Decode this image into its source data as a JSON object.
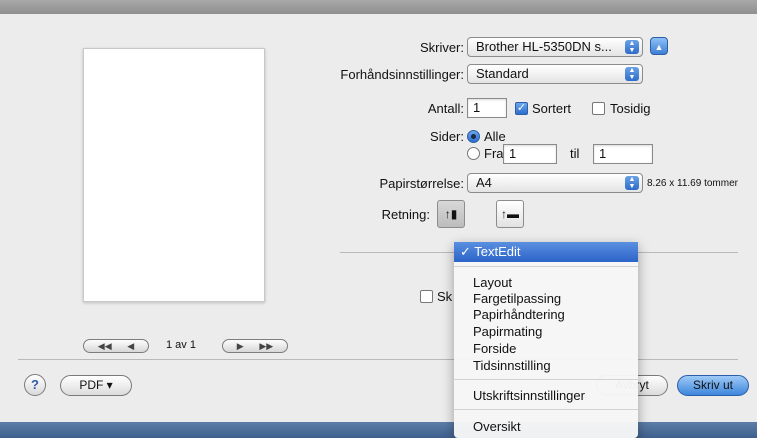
{
  "dialog": {
    "printer_label": "Skriver:",
    "printer_value": "Brother HL-5350DN s...",
    "presets_label": "Forhåndsinnstillinger:",
    "presets_value": "Standard",
    "copies_label": "Antall:",
    "copies_value": "1",
    "collated_label": "Sortert",
    "collated_checked": true,
    "twosided_label": "Tosidig",
    "twosided_checked": false,
    "pages_label": "Sider:",
    "pages_all_label": "Alle",
    "pages_from_label": "Fra",
    "pages_from_value": "1",
    "pages_to_label": "til",
    "pages_to_value": "1",
    "papersize_label": "Papirstørrelse:",
    "papersize_value": "A4",
    "papersize_dims": "8.26 x 11.69 tommer",
    "orientation_label": "Retning:",
    "hidden_option_label": "Sk",
    "pdf_button": "PDF ▾",
    "cancel_button": "Avbryt",
    "print_button": "Skriv ut",
    "help_button": "?"
  },
  "preview": {
    "page_indicator": "1 av 1"
  },
  "menu": {
    "selected": "TextEdit",
    "items": [
      "Layout",
      "Fargetilpassing",
      "Papirhåndtering",
      "Papirmating",
      "Forside",
      "Tidsinnstilling"
    ],
    "settings_item": "Utskriftsinnstillinger",
    "summary_item": "Oversikt"
  },
  "colors": {
    "accent": "#3d86dc",
    "menu_highlight": "#2c64c8",
    "sheet_bg": "#ececec"
  }
}
